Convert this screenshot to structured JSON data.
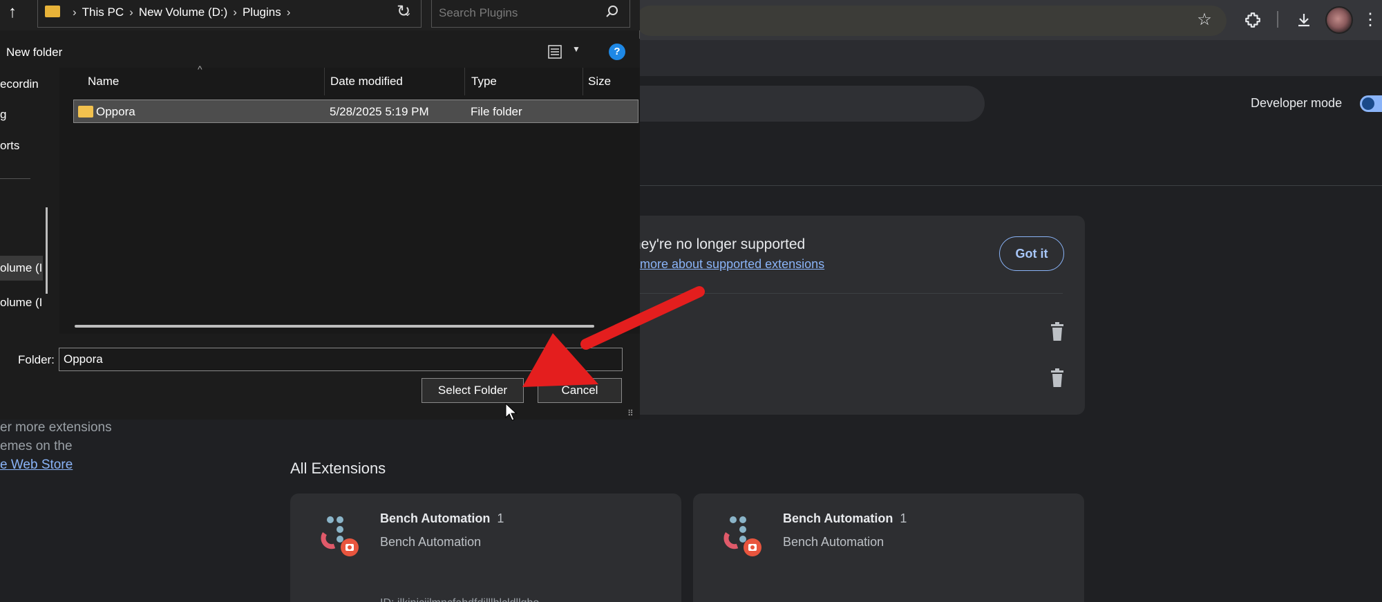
{
  "browser": {
    "icons": [
      "star-icon",
      "extensions-icon",
      "download-icon",
      "more-icon"
    ],
    "developer_mode_label": "Developer mode",
    "developer_mode_on": true
  },
  "extensions_page": {
    "unsupported_title": "ney're no longer supported",
    "unsupported_link": "more about supported extensions",
    "got_it": "Got it",
    "sidebar_webstore_lines": [
      "er more extensions",
      "emes on the",
      "e Web Store"
    ],
    "all_extensions": "All Extensions",
    "cards": [
      {
        "name": "Bench Automation",
        "version": "1",
        "description": "Bench Automation",
        "id": "ID: ilkjnjcjilmncfabdfdjlllhlcldllgbo"
      },
      {
        "name": "Bench Automation",
        "version": "1",
        "description": "Bench Automation",
        "id": ""
      }
    ]
  },
  "dialog": {
    "breadcrumbs": [
      "This PC",
      "New Volume (D:)",
      "Plugins"
    ],
    "search_placeholder": "Search Plugins",
    "new_folder": "New folder",
    "nav_items": [
      "ecordin",
      "g",
      "orts",
      "olume (I",
      "olume (I"
    ],
    "columns": [
      "Name",
      "Date modified",
      "Type",
      "Size"
    ],
    "rows": [
      {
        "name": "Oppora",
        "date": "5/28/2025 5:19 PM",
        "type": "File folder",
        "size": ""
      }
    ],
    "folder_label": "Folder:",
    "folder_value": "Oppora",
    "select_folder": "Select Folder",
    "cancel": "Cancel"
  },
  "colors": {
    "accent": "#8ab4f8",
    "arrow": "#e41e1e",
    "folder": "#f2c14e"
  }
}
